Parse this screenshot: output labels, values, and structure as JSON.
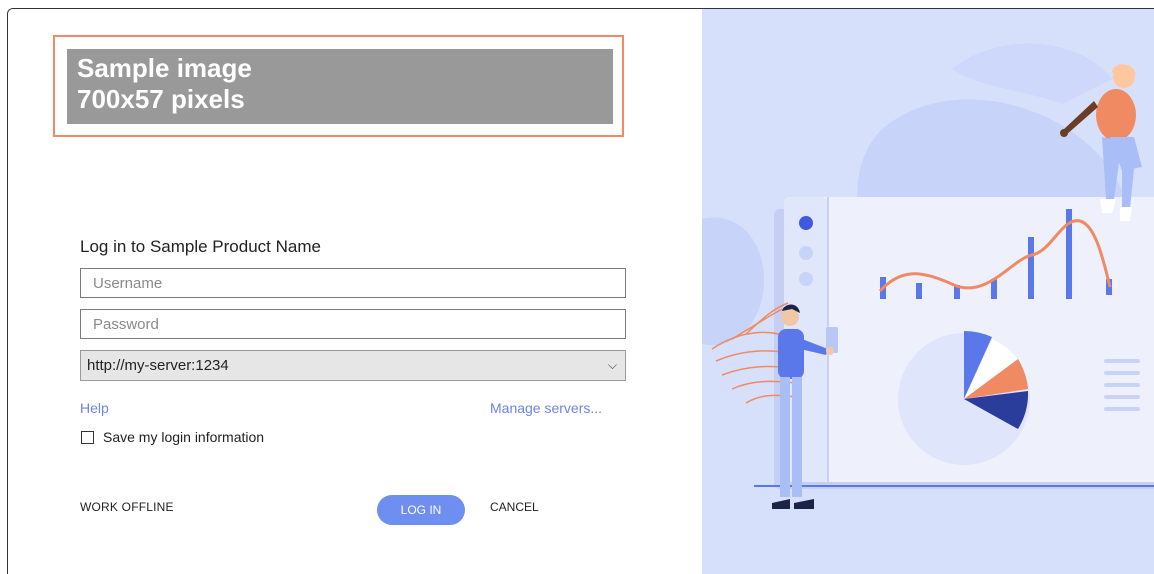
{
  "logo": {
    "line1": "Sample image",
    "line2": "700x57 pixels"
  },
  "login": {
    "title": "Log in to Sample Product Name",
    "username_placeholder": "Username",
    "username_value": "",
    "password_placeholder": "Password",
    "password_value": "",
    "server_value": "http://my-server:1234",
    "chevron": "⌵",
    "help_label": "Help",
    "manage_servers_label": "Manage servers...",
    "save_login_label": "Save my login information",
    "save_login_checked": false
  },
  "actions": {
    "work_offline_label": "WORK OFFLINE",
    "login_label": "LOG IN",
    "cancel_label": "CANCEL"
  },
  "colors": {
    "accent": "#6f8ff0",
    "link": "#6c84e8",
    "logo_border": "#ef8a62",
    "illustration_bg": "#d7e0fb"
  }
}
